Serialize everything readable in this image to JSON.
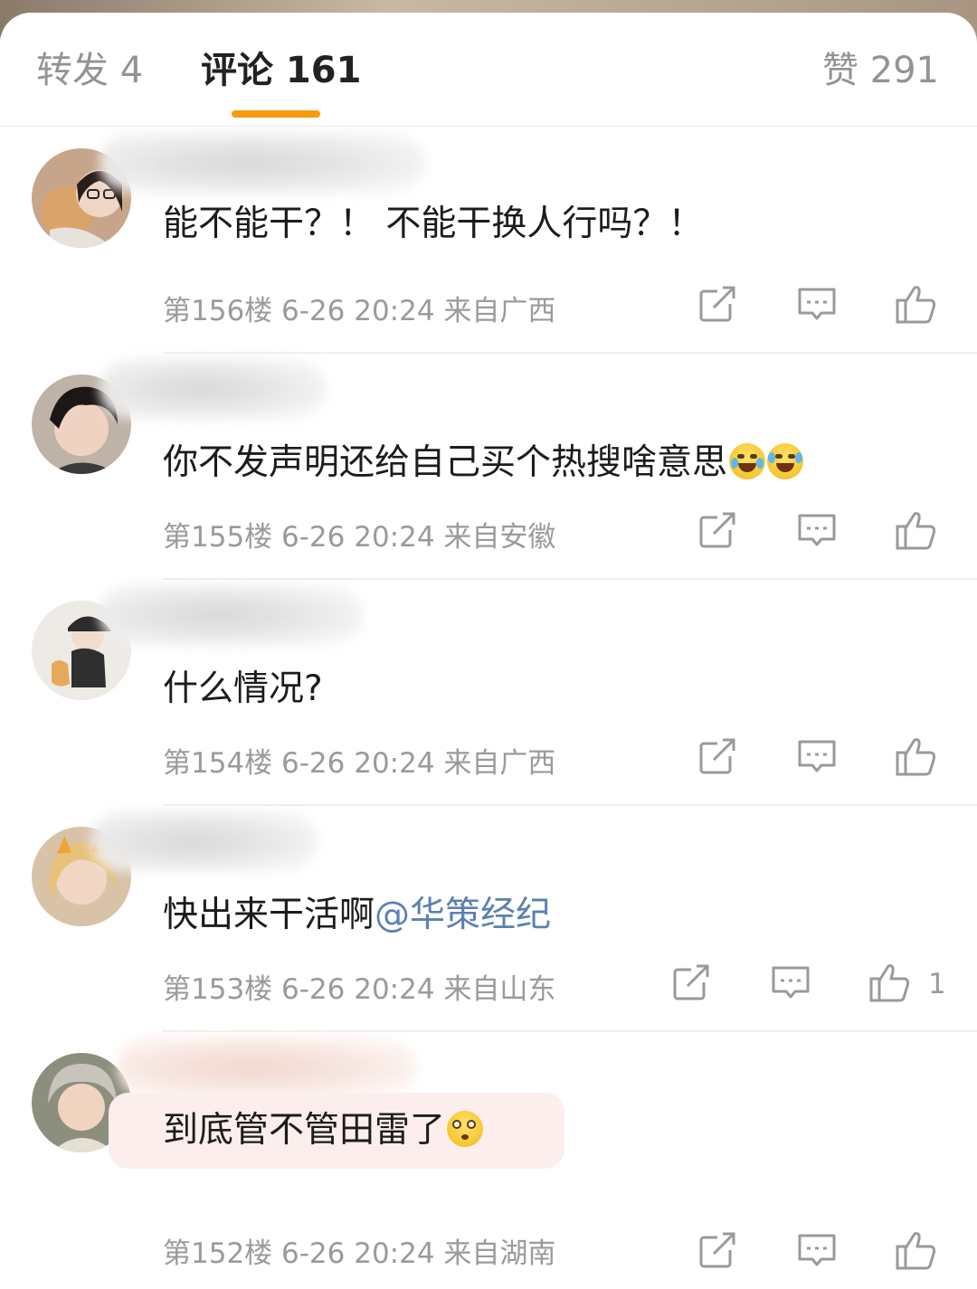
{
  "tabs": {
    "repost": "转发 4",
    "comment": "评论 161",
    "like": "赞 291"
  },
  "comments": [
    {
      "text": "能不能干？！ 不能干换人行吗？！",
      "meta": "第156楼 6-26 20:24 来自广西",
      "likes": ""
    },
    {
      "text": "你不发声明还给自己买个热搜啥意思",
      "emojis": [
        "crying-laughing-emoji",
        "laughing-emoji"
      ],
      "meta": "第155楼 6-26 20:24 来自安徽",
      "likes": ""
    },
    {
      "text": "什么情况?",
      "meta": "第154楼 6-26 20:24 来自广西",
      "likes": ""
    },
    {
      "text": "快出来干活啊",
      "mention": "@华策经纪",
      "meta": "第153楼 6-26 20:24 来自山东",
      "likes": "1"
    },
    {
      "text": "到底管不管田雷了",
      "emojis": [
        "eye-roll-emoji"
      ],
      "meta": "第152楼 6-26 20:24 来自湖南",
      "likes": ""
    }
  ],
  "colors": {
    "accent_underline": "#f79a0e",
    "mention": "#5b81b0",
    "meta_text": "#9a9a9a"
  }
}
